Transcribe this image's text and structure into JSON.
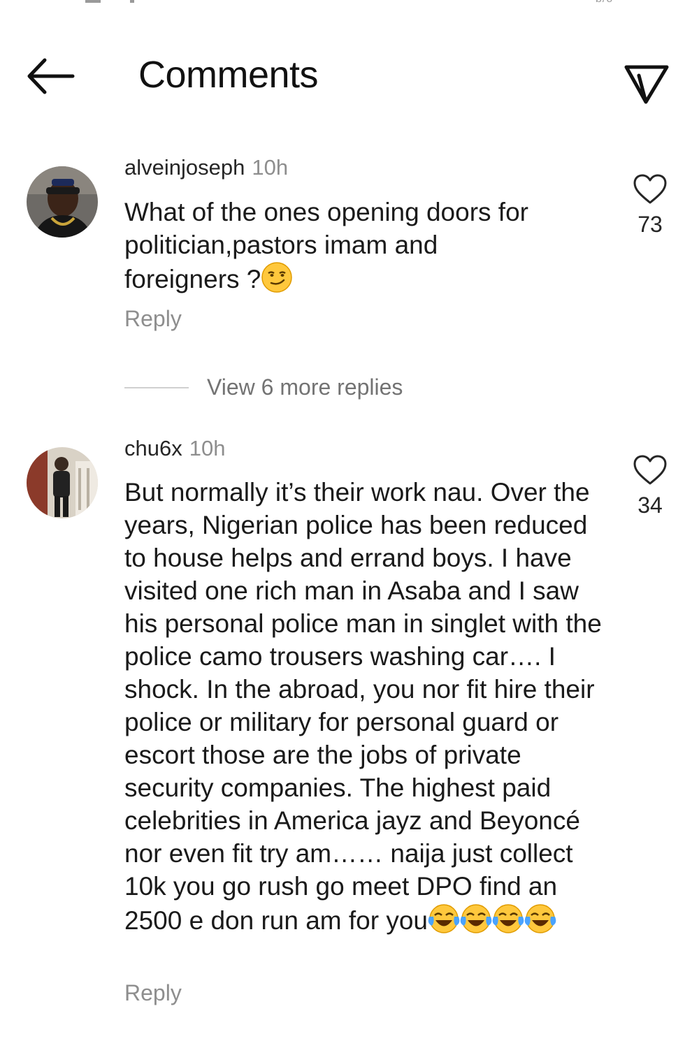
{
  "status_bar": {
    "right_fragment": "b/o"
  },
  "header": {
    "title": "Comments"
  },
  "comments": [
    {
      "username": "alveinjoseph",
      "time": "10h",
      "text": "What of the ones opening doors for politician,pastors imam and foreigners ?",
      "emoji": "smirking-face",
      "reply_label": "Reply",
      "likes": "73"
    },
    {
      "username": "chu6x",
      "time": "10h",
      "text": "But normally it’s their work nau. Over the years, Nigerian police has been reduced to house helps and errand boys. I have visited one rich man in Asaba and I saw his personal police man in singlet with the police camo trousers washing car…. I shock. In the abroad, you nor fit hire their police or military for personal guard or escort those are the jobs of private security companies. The highest paid celebrities in America jayz and Beyoncé nor even fit try am…… naija just collect 10k you go rush go meet DPO find an 2500 e don run am for you",
      "emoji": "face-with-tears-of-joy",
      "emoji_count": 4,
      "reply_label": "Reply",
      "likes": "34"
    }
  ],
  "view_replies": {
    "label": "View 6 more replies"
  },
  "icons": {
    "back": "back-arrow-icon",
    "share": "send-icon",
    "like": "heart-icon"
  },
  "colors": {
    "text": "#262626",
    "muted": "#8e8e8e",
    "background": "#ffffff"
  }
}
